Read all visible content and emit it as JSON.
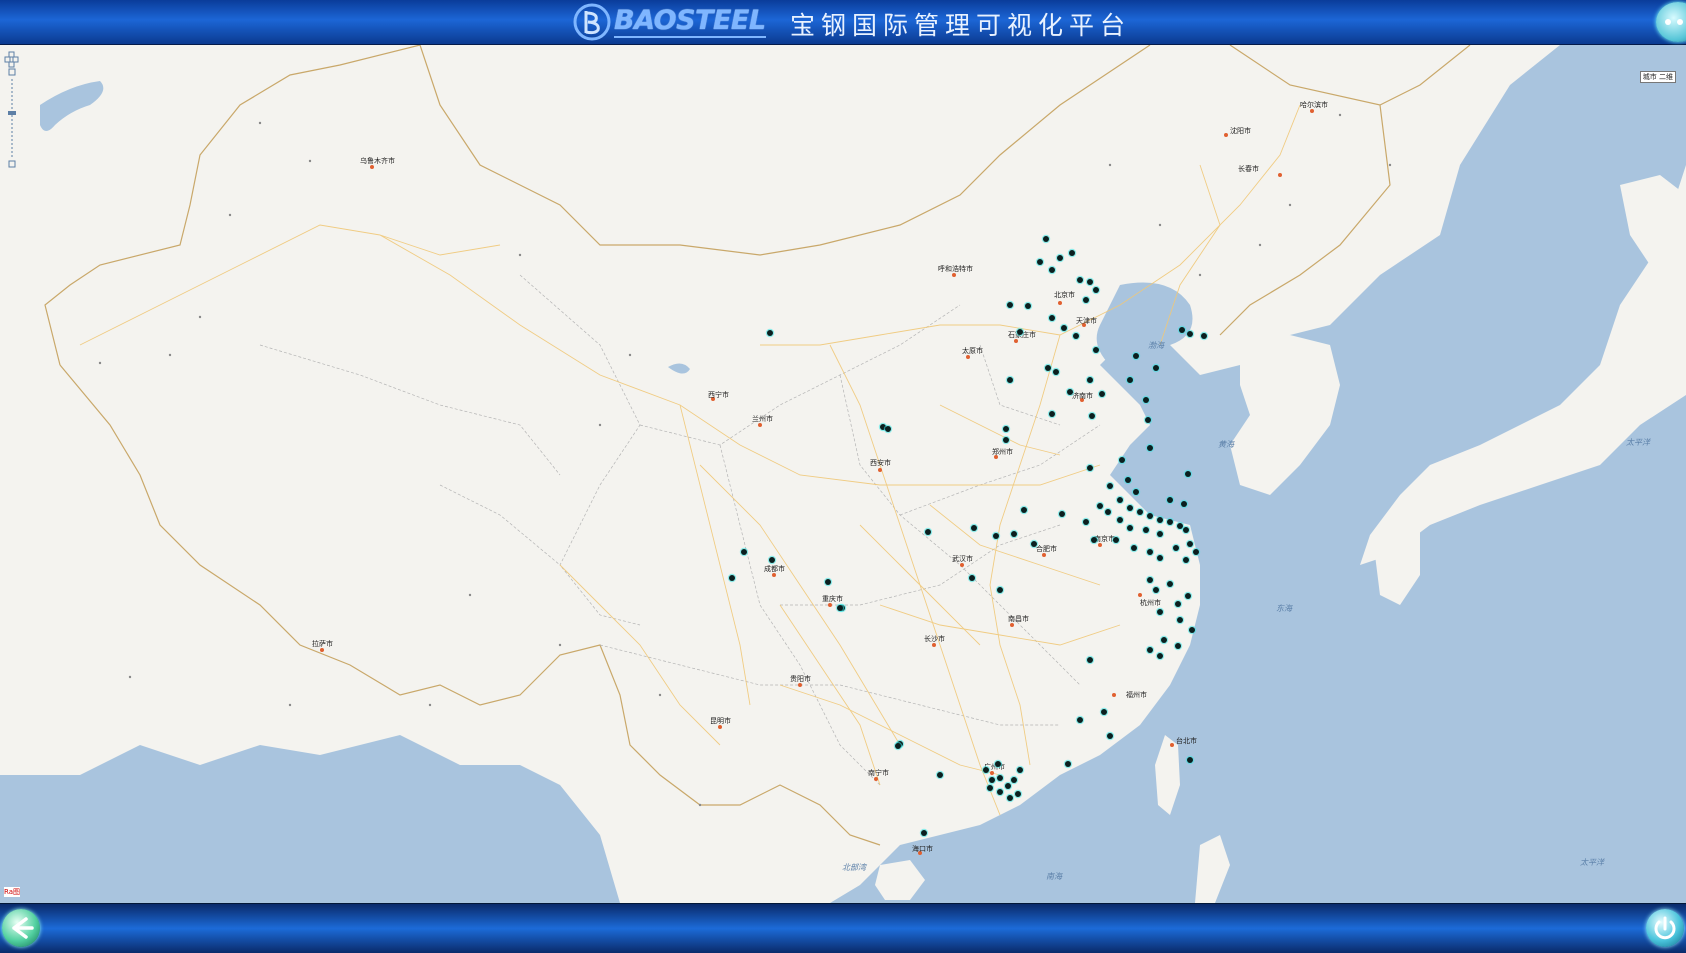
{
  "header": {
    "logo_text": "BAOSTEEL",
    "title": "宝钢国际管理可视化平台",
    "colors": {
      "bar": "#1c66d6",
      "logo": "#7fb6ff"
    }
  },
  "map": {
    "scale_label": "城市 二维",
    "copyright": "Ra图 ",
    "marker_color": "#0b1f1f",
    "marker_halo": "#39e6e6",
    "seas": [
      {
        "name": "渤海"
      },
      {
        "name": "黄海"
      },
      {
        "name": "东海"
      },
      {
        "name": "太平洋"
      },
      {
        "name": "北部湾"
      },
      {
        "name": "南海"
      },
      {
        "name": "太平洋"
      }
    ],
    "cities": [
      {
        "name": "乌鲁木齐市"
      },
      {
        "name": "呼和浩特市"
      },
      {
        "name": "北京市"
      },
      {
        "name": "天津市"
      },
      {
        "name": "石家庄市"
      },
      {
        "name": "太原市"
      },
      {
        "name": "济南市"
      },
      {
        "name": "郑州市"
      },
      {
        "name": "西宁市"
      },
      {
        "name": "兰州市"
      },
      {
        "name": "西安市"
      },
      {
        "name": "沈阳市"
      },
      {
        "name": "长春市"
      },
      {
        "name": "哈尔滨市"
      },
      {
        "name": "合肥市"
      },
      {
        "name": "南京市"
      },
      {
        "name": "武汉市"
      },
      {
        "name": "成都市"
      },
      {
        "name": "重庆市"
      },
      {
        "name": "长沙市"
      },
      {
        "name": "南昌市"
      },
      {
        "name": "福州市"
      },
      {
        "name": "贵阳市"
      },
      {
        "name": "昆明市"
      },
      {
        "name": "南宁市"
      },
      {
        "name": "广州市"
      },
      {
        "name": "海口市"
      },
      {
        "name": "拉萨市"
      },
      {
        "name": "台北市"
      },
      {
        "name": "杭州市"
      }
    ]
  },
  "footer": {
    "back_icon": "arrow-left-icon",
    "power_icon": "power-icon"
  }
}
